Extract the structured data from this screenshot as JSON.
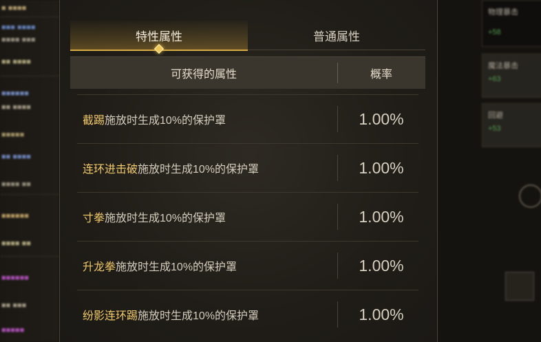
{
  "tabs": {
    "special_label": "特性属性",
    "normal_label": "普通属性",
    "active": "special"
  },
  "table": {
    "col_attribute": "可获得的属性",
    "col_rate": "概率",
    "rows": [
      {
        "skill": "截踢",
        "effect": "施放时生成10%的保护罩",
        "rate": "1.00%"
      },
      {
        "skill": "连环进击破",
        "effect": "施放时生成10%的保护罩",
        "rate": "1.00%"
      },
      {
        "skill": "寸拳",
        "effect": "施放时生成10%的保护罩",
        "rate": "1.00%"
      },
      {
        "skill": "升龙拳",
        "effect": "施放时生成10%的保护罩",
        "rate": "1.00%"
      },
      {
        "skill": "纷影连环踢",
        "effect": "施放时生成10%的保护罩",
        "rate": "1.00%"
      }
    ]
  },
  "colors": {
    "skill_name": "#f0c96a",
    "effect_text": "#d6cebe",
    "active_tab_underline": "#d9ac45"
  },
  "right_background": {
    "cards": [
      {
        "label": "物理暴击",
        "value": "+58"
      },
      {
        "label": "魔法暴击",
        "value": "+63"
      },
      {
        "label": "回避",
        "value": "+53"
      }
    ]
  }
}
